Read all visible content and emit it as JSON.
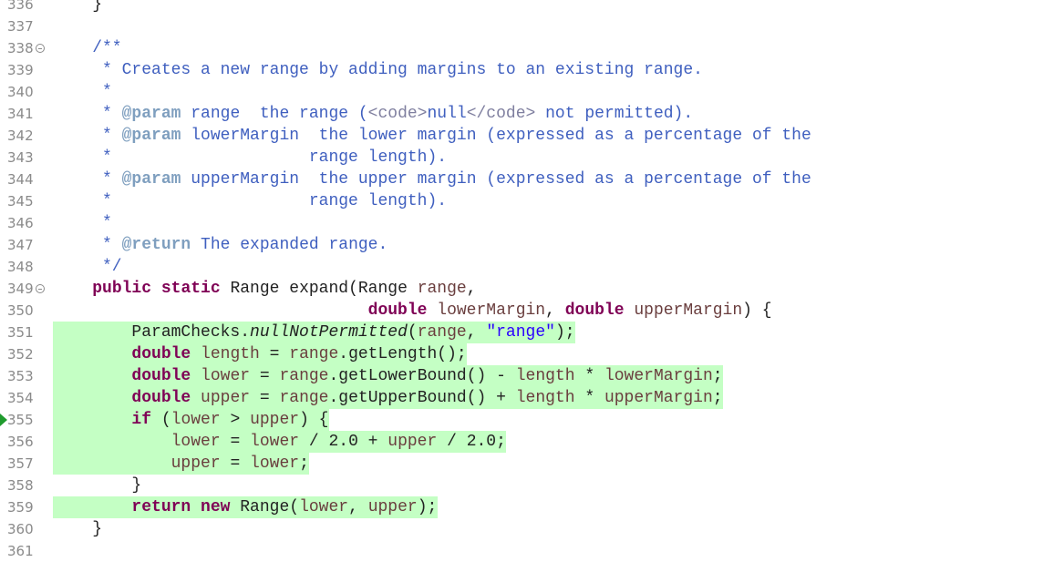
{
  "colors": {
    "background": "#ffffff",
    "line_number": "#8a8a8a",
    "coverage_highlight": "#c4ffc4",
    "comment": "#3f5fbf",
    "javadoc_tag": "#7f9fbf",
    "html_tag": "#7f7f9f",
    "keyword": "#7f0055",
    "string": "#2a00ff",
    "parameter": "#6a3e3e",
    "debug_arrow": "#1f9b2d"
  },
  "lines": [
    {
      "num": "336",
      "fold": false,
      "arrow": false,
      "highlight": false,
      "tokens": [
        {
          "t": "    }",
          "c": "plain"
        }
      ]
    },
    {
      "num": "337",
      "fold": false,
      "arrow": false,
      "highlight": false,
      "tokens": []
    },
    {
      "num": "338",
      "fold": true,
      "arrow": false,
      "highlight": false,
      "tokens": [
        {
          "t": "    /**",
          "c": "comment"
        }
      ]
    },
    {
      "num": "339",
      "fold": false,
      "arrow": false,
      "highlight": false,
      "tokens": [
        {
          "t": "     * Creates a new range by adding margins to an existing range.",
          "c": "comment"
        }
      ]
    },
    {
      "num": "340",
      "fold": false,
      "arrow": false,
      "highlight": false,
      "tokens": [
        {
          "t": "     *",
          "c": "comment"
        }
      ]
    },
    {
      "num": "341",
      "fold": false,
      "arrow": false,
      "highlight": false,
      "tokens": [
        {
          "t": "     * ",
          "c": "comment"
        },
        {
          "t": "@param",
          "c": "ckey"
        },
        {
          "t": " range  the range (",
          "c": "comment"
        },
        {
          "t": "<code>",
          "c": "tag"
        },
        {
          "t": "null",
          "c": "comment"
        },
        {
          "t": "</code>",
          "c": "tag"
        },
        {
          "t": " not permitted).",
          "c": "comment"
        }
      ]
    },
    {
      "num": "342",
      "fold": false,
      "arrow": false,
      "highlight": false,
      "tokens": [
        {
          "t": "     * ",
          "c": "comment"
        },
        {
          "t": "@param",
          "c": "ckey"
        },
        {
          "t": " lowerMargin  the lower margin (expressed as a percentage of the",
          "c": "comment"
        }
      ]
    },
    {
      "num": "343",
      "fold": false,
      "arrow": false,
      "highlight": false,
      "tokens": [
        {
          "t": "     *                    range length).",
          "c": "comment"
        }
      ]
    },
    {
      "num": "344",
      "fold": false,
      "arrow": false,
      "highlight": false,
      "tokens": [
        {
          "t": "     * ",
          "c": "comment"
        },
        {
          "t": "@param",
          "c": "ckey"
        },
        {
          "t": " upperMargin  the upper margin (expressed as a percentage of the",
          "c": "comment"
        }
      ]
    },
    {
      "num": "345",
      "fold": false,
      "arrow": false,
      "highlight": false,
      "tokens": [
        {
          "t": "     *                    range length).",
          "c": "comment"
        }
      ]
    },
    {
      "num": "346",
      "fold": false,
      "arrow": false,
      "highlight": false,
      "tokens": [
        {
          "t": "     *",
          "c": "comment"
        }
      ]
    },
    {
      "num": "347",
      "fold": false,
      "arrow": false,
      "highlight": false,
      "tokens": [
        {
          "t": "     * ",
          "c": "comment"
        },
        {
          "t": "@return",
          "c": "ckey"
        },
        {
          "t": " The expanded range.",
          "c": "comment"
        }
      ]
    },
    {
      "num": "348",
      "fold": false,
      "arrow": false,
      "highlight": false,
      "tokens": [
        {
          "t": "     */",
          "c": "comment"
        }
      ]
    },
    {
      "num": "349",
      "fold": true,
      "arrow": false,
      "highlight": false,
      "tokens": [
        {
          "t": "    ",
          "c": "plain"
        },
        {
          "t": "public",
          "c": "kw"
        },
        {
          "t": " ",
          "c": "plain"
        },
        {
          "t": "static",
          "c": "kw"
        },
        {
          "t": " Range expand(Range ",
          "c": "plain"
        },
        {
          "t": "range",
          "c": "var"
        },
        {
          "t": ",",
          "c": "plain"
        }
      ]
    },
    {
      "num": "350",
      "fold": false,
      "arrow": false,
      "highlight": false,
      "tokens": [
        {
          "t": "                                ",
          "c": "plain"
        },
        {
          "t": "double",
          "c": "kw"
        },
        {
          "t": " ",
          "c": "plain"
        },
        {
          "t": "lowerMargin",
          "c": "var"
        },
        {
          "t": ", ",
          "c": "plain"
        },
        {
          "t": "double",
          "c": "kw"
        },
        {
          "t": " ",
          "c": "plain"
        },
        {
          "t": "upperMargin",
          "c": "var"
        },
        {
          "t": ") {",
          "c": "plain"
        }
      ]
    },
    {
      "num": "351",
      "fold": false,
      "arrow": false,
      "highlight": true,
      "tokens": [
        {
          "t": "        ParamChecks.",
          "c": "plain"
        },
        {
          "t": "nullNotPermitted",
          "c": "ital"
        },
        {
          "t": "(",
          "c": "plain"
        },
        {
          "t": "range",
          "c": "var"
        },
        {
          "t": ", ",
          "c": "plain"
        },
        {
          "t": "\"range\"",
          "c": "str"
        },
        {
          "t": ");",
          "c": "plain"
        }
      ]
    },
    {
      "num": "352",
      "fold": false,
      "arrow": false,
      "highlight": true,
      "tokens": [
        {
          "t": "        ",
          "c": "plain"
        },
        {
          "t": "double",
          "c": "kw"
        },
        {
          "t": " ",
          "c": "plain"
        },
        {
          "t": "length",
          "c": "var"
        },
        {
          "t": " = ",
          "c": "plain"
        },
        {
          "t": "range",
          "c": "var"
        },
        {
          "t": ".getLength();",
          "c": "plain"
        }
      ]
    },
    {
      "num": "353",
      "fold": false,
      "arrow": false,
      "highlight": true,
      "tokens": [
        {
          "t": "        ",
          "c": "plain"
        },
        {
          "t": "double",
          "c": "kw"
        },
        {
          "t": " ",
          "c": "plain"
        },
        {
          "t": "lower",
          "c": "var"
        },
        {
          "t": " = ",
          "c": "plain"
        },
        {
          "t": "range",
          "c": "var"
        },
        {
          "t": ".getLowerBound() - ",
          "c": "plain"
        },
        {
          "t": "length",
          "c": "var"
        },
        {
          "t": " * ",
          "c": "plain"
        },
        {
          "t": "lowerMargin",
          "c": "var"
        },
        {
          "t": ";",
          "c": "plain"
        }
      ]
    },
    {
      "num": "354",
      "fold": false,
      "arrow": false,
      "highlight": true,
      "tokens": [
        {
          "t": "        ",
          "c": "plain"
        },
        {
          "t": "double",
          "c": "kw"
        },
        {
          "t": " ",
          "c": "plain"
        },
        {
          "t": "upper",
          "c": "var"
        },
        {
          "t": " = ",
          "c": "plain"
        },
        {
          "t": "range",
          "c": "var"
        },
        {
          "t": ".getUpperBound() + ",
          "c": "plain"
        },
        {
          "t": "length",
          "c": "var"
        },
        {
          "t": " * ",
          "c": "plain"
        },
        {
          "t": "upperMargin",
          "c": "var"
        },
        {
          "t": ";",
          "c": "plain"
        }
      ]
    },
    {
      "num": "355",
      "fold": false,
      "arrow": true,
      "highlight": true,
      "tokens": [
        {
          "t": "        ",
          "c": "plain"
        },
        {
          "t": "if",
          "c": "kw"
        },
        {
          "t": " (",
          "c": "plain"
        },
        {
          "t": "lower",
          "c": "var"
        },
        {
          "t": " > ",
          "c": "plain"
        },
        {
          "t": "upper",
          "c": "var"
        },
        {
          "t": ") {",
          "c": "plain"
        }
      ]
    },
    {
      "num": "356",
      "fold": false,
      "arrow": false,
      "highlight": true,
      "tokens": [
        {
          "t": "            ",
          "c": "plain"
        },
        {
          "t": "lower",
          "c": "var"
        },
        {
          "t": " = ",
          "c": "plain"
        },
        {
          "t": "lower",
          "c": "var"
        },
        {
          "t": " / 2.0 + ",
          "c": "plain"
        },
        {
          "t": "upper",
          "c": "var"
        },
        {
          "t": " / 2.0;",
          "c": "plain"
        }
      ]
    },
    {
      "num": "357",
      "fold": false,
      "arrow": false,
      "highlight": true,
      "tokens": [
        {
          "t": "            ",
          "c": "plain"
        },
        {
          "t": "upper",
          "c": "var"
        },
        {
          "t": " = ",
          "c": "plain"
        },
        {
          "t": "lower",
          "c": "var"
        },
        {
          "t": ";",
          "c": "plain"
        }
      ]
    },
    {
      "num": "358",
      "fold": false,
      "arrow": false,
      "highlight": false,
      "tokens": [
        {
          "t": "        }",
          "c": "plain"
        }
      ]
    },
    {
      "num": "359",
      "fold": false,
      "arrow": false,
      "highlight": true,
      "tokens": [
        {
          "t": "        ",
          "c": "plain"
        },
        {
          "t": "return",
          "c": "kw"
        },
        {
          "t": " ",
          "c": "plain"
        },
        {
          "t": "new",
          "c": "kw"
        },
        {
          "t": " Range(",
          "c": "plain"
        },
        {
          "t": "lower",
          "c": "var"
        },
        {
          "t": ", ",
          "c": "plain"
        },
        {
          "t": "upper",
          "c": "var"
        },
        {
          "t": ");",
          "c": "plain"
        }
      ]
    },
    {
      "num": "360",
      "fold": false,
      "arrow": false,
      "highlight": false,
      "tokens": [
        {
          "t": "    }",
          "c": "plain"
        }
      ]
    },
    {
      "num": "361",
      "fold": false,
      "arrow": false,
      "highlight": false,
      "tokens": []
    }
  ]
}
